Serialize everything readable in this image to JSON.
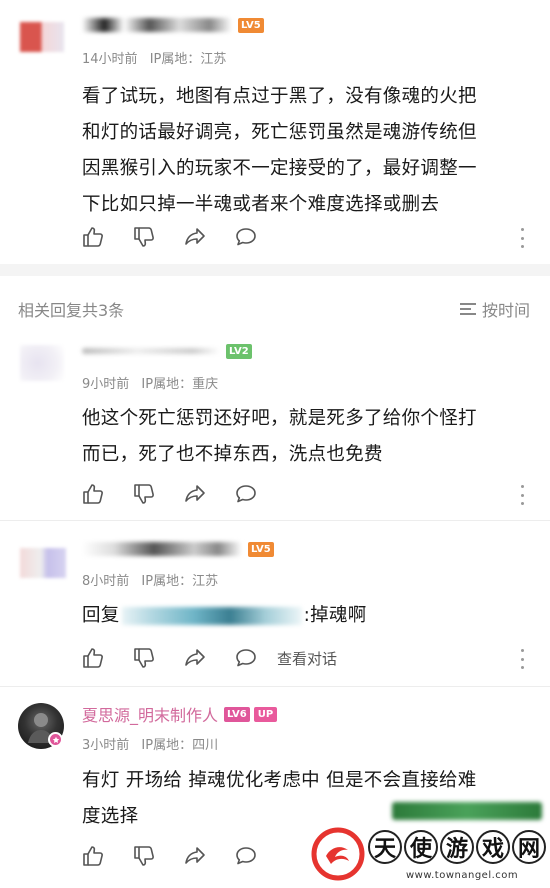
{
  "comments": [
    {
      "level": "LV5",
      "level_color": "#f08a34",
      "time": "14小时前",
      "ip": "IP属地：江苏",
      "text_lines": [
        "看了试玩，地图有点过于黑了，没有像魂的火把",
        "和灯的话最好调亮，死亡惩罚虽然是魂游传统但",
        "因黑猴引入的玩家不一定接受的了，最好调整一",
        "下比如只掉一半魂或者来个难度选择或删去"
      ]
    }
  ],
  "replies_header": {
    "label": "相关回复共3条",
    "sort_label": "按时间"
  },
  "replies": [
    {
      "level": "LV2",
      "level_color": "#6cc26c",
      "time": "9小时前",
      "ip": "IP属地：重庆",
      "text_lines": [
        "他这个死亡惩罚还好吧，就是死多了给你个怪打",
        "而已，死了也不掉东西，洗点也免费"
      ]
    },
    {
      "level": "LV5",
      "level_color": "#f08a34",
      "time": "8小时前",
      "ip": "IP属地：江苏",
      "reply_prefix": "回复",
      "reply_suffix": ":掉魂啊",
      "view_conversation": "查看对话"
    },
    {
      "name": "夏思源_明末制作人",
      "name_color": "#d26a9c",
      "level": "LV6",
      "level_color": "#e0569a",
      "up_badge": "UP",
      "time": "3小时前",
      "ip": "IP属地：四川",
      "text_lines": [
        "有灯 开场给  掉魂优化考虑中  但是不会直接给难",
        "度选择"
      ]
    }
  ],
  "watermark": {
    "chars": [
      "天",
      "使",
      "游",
      "戏",
      "网"
    ],
    "url": "www.townangel.com"
  },
  "icons": {
    "like": "thumbs-up-icon",
    "dislike": "thumbs-down-icon",
    "share": "share-icon",
    "comment": "comment-icon",
    "more": "more-icon"
  }
}
